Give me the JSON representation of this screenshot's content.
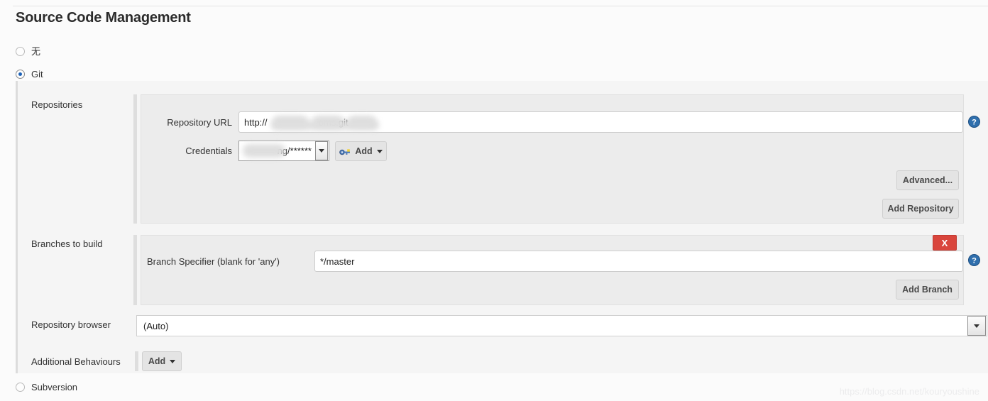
{
  "page": {
    "title": "Source Code Management",
    "watermark": "https://blog.csdn.net/kouryoushine"
  },
  "scm_options": [
    {
      "label": "无",
      "checked": false,
      "name": "scm-none"
    },
    {
      "label": "Git",
      "checked": true,
      "name": "scm-git"
    },
    {
      "label": "Subversion",
      "checked": false,
      "name": "scm-subversion"
    }
  ],
  "git": {
    "repositories": {
      "section_label": "Repositories",
      "url_label": "Repository URL",
      "url_prefix": "http://",
      "url_suffix": "oms.git",
      "url_value": "http://                    oms.git",
      "credentials_label": "Credentials",
      "credentials_value": "ng/******",
      "add_credentials_label": "Add",
      "advanced_label": "Advanced...",
      "add_repository_label": "Add Repository"
    },
    "branches": {
      "section_label": "Branches to build",
      "specifier_label": "Branch Specifier (blank for 'any')",
      "specifier_value": "*/master",
      "delete_label": "X",
      "add_branch_label": "Add Branch"
    },
    "repository_browser": {
      "label": "Repository browser",
      "selected": "(Auto)",
      "options": [
        "(Auto)"
      ]
    },
    "additional_behaviours": {
      "label": "Additional Behaviours",
      "add_label": "Add"
    }
  },
  "icons": {
    "help": "help-icon",
    "key": "key-icon",
    "caret": "chevron-down-icon"
  },
  "colors": {
    "accent_blue": "#1d62b7",
    "danger_red": "#d9453c",
    "panel_bg": "#ececec",
    "body_bg": "#f5f5f5"
  }
}
